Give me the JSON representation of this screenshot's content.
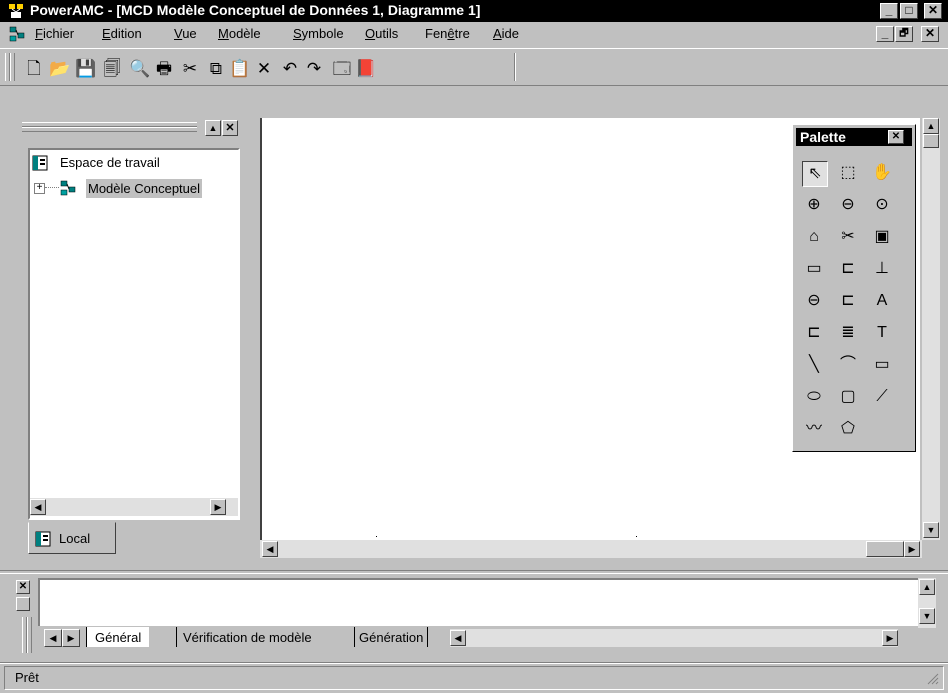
{
  "window": {
    "title": "PowerAMC - [MCD Modèle Conceptuel de Données 1, Diagramme 1]",
    "minimize": "_",
    "maximize": "□",
    "close": "✕",
    "child_minimize": "_",
    "child_restore": "🗗",
    "child_close": "✕"
  },
  "menu": {
    "items": [
      {
        "ul": "F",
        "rest": "ichier"
      },
      {
        "ul": "E",
        "rest": "dition"
      },
      {
        "ul": "V",
        "rest": "ue"
      },
      {
        "ul": "M",
        "rest": "odèle"
      },
      {
        "ul": "S",
        "rest": "ymbole"
      },
      {
        "ul": "O",
        "rest": "utils"
      },
      {
        "pre": "Fen",
        "ul": "ê",
        "rest": "tre"
      },
      {
        "ul": "A",
        "rest": "ide"
      }
    ]
  },
  "toolbar": {
    "icons": [
      "new-icon",
      "open-icon",
      "save-icon",
      "save-all-icon",
      "print-preview-icon",
      "print-icon",
      "cut-icon",
      "copy-icon",
      "paste-icon",
      "delete-icon",
      "undo-icon",
      "redo-icon",
      "properties-icon",
      "help-book-icon"
    ],
    "glyphs": [
      "🗋",
      "📂",
      "💾",
      "🗐",
      "🔍",
      "🖶",
      "✂",
      "⧉",
      "📋",
      "✕",
      "↶",
      "↷",
      "🗔",
      "📕"
    ]
  },
  "browser": {
    "root_label": "Espace de travail",
    "child_label": "Modèle Conceptuel",
    "expand_glyph": "+",
    "tab_label": "Local"
  },
  "palette": {
    "title": "Palette",
    "close": "✕",
    "tools": [
      {
        "name": "pointer-icon",
        "g": "⇖"
      },
      {
        "name": "lasso-select-icon",
        "g": "⬚"
      },
      {
        "name": "grabber-hand-icon",
        "g": "✋"
      },
      {
        "name": "zoom-in-icon",
        "g": "⊕"
      },
      {
        "name": "zoom-out-icon",
        "g": "⊖"
      },
      {
        "name": "zoom-fit-icon",
        "g": "⊙"
      },
      {
        "name": "open-package-icon",
        "g": "⌂"
      },
      {
        "name": "delete-link-icon",
        "g": "✂"
      },
      {
        "name": "properties-tool-icon",
        "g": "▣"
      },
      {
        "name": "entity-icon",
        "g": "▭"
      },
      {
        "name": "relationship-icon",
        "g": "⊏"
      },
      {
        "name": "inheritance-icon",
        "g": "⊥"
      },
      {
        "name": "association-icon",
        "g": "⊖"
      },
      {
        "name": "association-link-icon",
        "g": "⊏"
      },
      {
        "name": "text-style-icon",
        "g": "A"
      },
      {
        "name": "package-icon",
        "g": "⊏"
      },
      {
        "name": "list-icon",
        "g": "≣"
      },
      {
        "name": "text-tool-icon",
        "g": "T"
      },
      {
        "name": "line-icon",
        "g": "╲"
      },
      {
        "name": "arc-icon",
        "g": "⌒"
      },
      {
        "name": "rectangle-icon",
        "g": "▭"
      },
      {
        "name": "ellipse-icon",
        "g": "⬭"
      },
      {
        "name": "rounded-rectangle-icon",
        "g": "▢"
      },
      {
        "name": "polyline-icon",
        "g": "⟋"
      },
      {
        "name": "freeform-line-icon",
        "g": "〰"
      },
      {
        "name": "polygon-icon",
        "g": "⬠"
      }
    ]
  },
  "output": {
    "tabs": [
      "Général",
      "Vérification de modèle",
      "Génération"
    ]
  },
  "status": {
    "text": "Prêt"
  }
}
